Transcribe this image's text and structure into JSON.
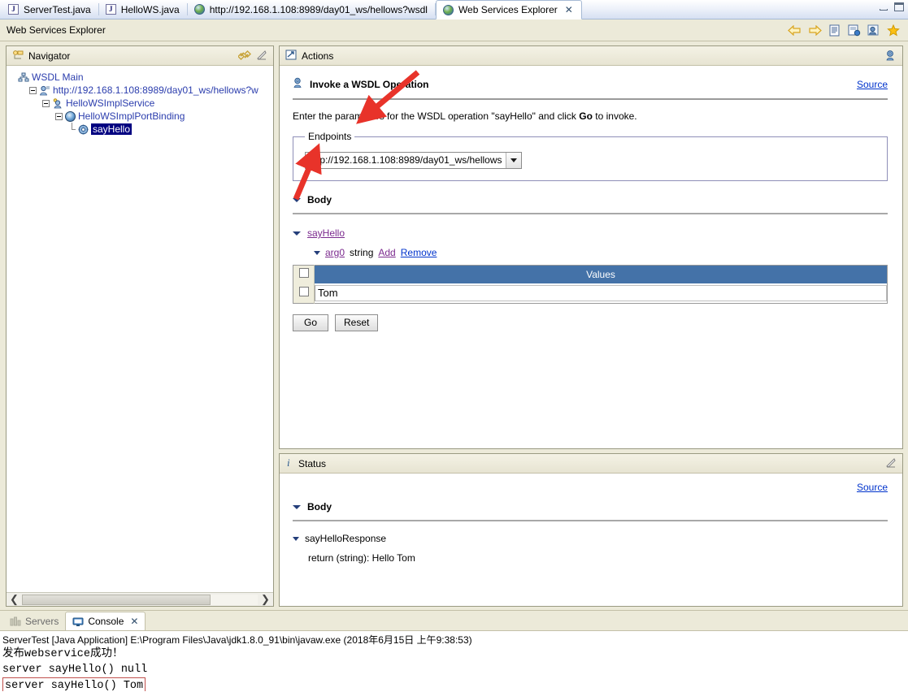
{
  "window": {
    "minimize_label": "Minimize",
    "maximize_label": "Maximize"
  },
  "editor_tabs": [
    {
      "label": "ServerTest.java",
      "icon": "java-file-icon",
      "active": false
    },
    {
      "label": "HelloWS.java",
      "icon": "java-file-icon",
      "active": false
    },
    {
      "label": "http://192.168.1.108:8989/day01_ws/hellows?wsdl",
      "icon": "globe-icon",
      "active": false
    },
    {
      "label": "Web Services Explorer",
      "icon": "globe-icon",
      "active": true,
      "close": "✕"
    }
  ],
  "view_bar": {
    "title": "Web Services Explorer",
    "tools": [
      {
        "name": "back-icon",
        "label": "Back"
      },
      {
        "name": "forward-icon",
        "label": "Forward"
      },
      {
        "name": "wsdl-page-icon",
        "label": "WSDL Page"
      },
      {
        "name": "wsil-page-icon",
        "label": "WSIL Page"
      },
      {
        "name": "uddi-page-icon",
        "label": "UDDI Page"
      },
      {
        "name": "favorites-icon",
        "label": "Favorites"
      }
    ]
  },
  "navigator": {
    "title": "Navigator",
    "tool_icons": [
      {
        "name": "link-with-editor-icon"
      },
      {
        "name": "maximize-pane-icon"
      }
    ],
    "tree": [
      {
        "label": "WSDL Main",
        "icon": "wsdl-main-icon",
        "indent": 0,
        "expander": "none",
        "selected": false
      },
      {
        "label": "http://192.168.1.108:8989/day01_ws/hellows?w",
        "icon": "wsdl-service-icon",
        "indent": 1,
        "expander": "minus",
        "selected": false
      },
      {
        "label": "HelloWSImplService",
        "icon": "service-icon",
        "indent": 2,
        "expander": "minus",
        "selected": false
      },
      {
        "label": "HelloWSImplPortBinding",
        "icon": "port-icon",
        "indent": 3,
        "expander": "minus",
        "selected": false
      },
      {
        "label": "sayHello",
        "icon": "operation-gear-icon",
        "indent": 4,
        "expander": "leaf",
        "selected": true
      }
    ],
    "scrollbar": {
      "left": "❮",
      "right": "❯"
    }
  },
  "actions": {
    "title": "Actions",
    "pane_icon": "actions-pane-icon",
    "tool_icon": "invoke-wsdl-icon",
    "heading": "Invoke a WSDL Operation",
    "source_link": "Source",
    "description": "Enter the parameters for the WSDL operation \"sayHello\" and click Go to invoke.",
    "description_parts": {
      "before": "Enter the parameters for the WSDL operation \"sayHello\" and click ",
      "bold": "Go",
      "after": " to invoke."
    },
    "endpoints": {
      "legend": "Endpoints",
      "selected_value": "http://192.168.1.108:8989/day01_ws/hellows",
      "options": [
        "http://192.168.1.108:8989/day01_ws/hellows"
      ]
    },
    "body_label": "Body",
    "operation_link": "sayHello",
    "arg": {
      "name_link": "arg0",
      "type": "string",
      "add_link": "Add",
      "remove_link": "Remove"
    },
    "values_table": {
      "header": "Values",
      "rows": [
        {
          "checked": false,
          "value": "Tom"
        }
      ]
    },
    "buttons": {
      "go": "Go",
      "reset": "Reset"
    }
  },
  "status": {
    "title": "Status",
    "info_icon": "info-icon",
    "tool_icon": "maximize-pane-icon",
    "source_link": "Source",
    "body_label": "Body",
    "response_node": "sayHelloResponse",
    "return_line": "return (string): Hello Tom"
  },
  "bottom_tabs": [
    {
      "label": "Servers",
      "icon": "servers-icon",
      "active": false
    },
    {
      "label": "Console",
      "icon": "console-icon",
      "active": true,
      "close": "✕"
    }
  ],
  "console": {
    "header": "ServerTest [Java Application] E:\\Program Files\\Java\\jdk1.8.0_91\\bin\\javaw.exe (2018年6月15日 上午9:38:53)",
    "lines": [
      {
        "text": "发布webservice成功！",
        "boxed": false
      },
      {
        "text": "server sayHello() null",
        "boxed": false
      },
      {
        "text": "server sayHello() Tom",
        "boxed": true
      }
    ]
  },
  "annotations": {
    "arrow_to_value_field": "red-arrow-pointing-to-value-input",
    "arrow_to_go_button": "red-arrow-pointing-to-go-button"
  },
  "colors": {
    "table_header_blue": "#4472a8",
    "selection_navy": "#000080",
    "link_blue": "#0033cc",
    "link_purple": "#7b2a8e",
    "annotation_red": "#e8332a",
    "chrome_beige": "#ecead9"
  }
}
